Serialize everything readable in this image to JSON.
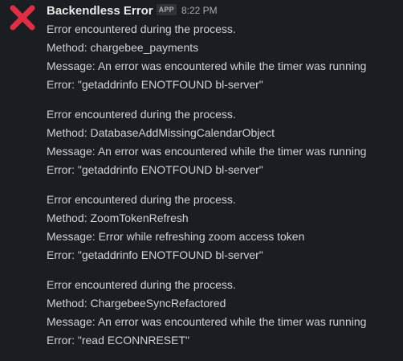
{
  "message": {
    "sender": "Backendless Error",
    "badge": "APP",
    "time": "8:22 PM",
    "avatar_icon": "red-x-icon",
    "avatar_color": "#dd2e44",
    "blocks": [
      {
        "line1": "Error encountered during the process.",
        "line2": "Method: chargebee_payments",
        "line3": "Message: An error was encountered while the timer was running",
        "line4": "Error: \"getaddrinfo ENOTFOUND bl-server\""
      },
      {
        "line1": "Error encountered during the process.",
        "line2": "Method: DatabaseAddMissingCalendarObject",
        "line3": "Message: An error was encountered while the timer was running",
        "line4": "Error: \"getaddrinfo ENOTFOUND bl-server\""
      },
      {
        "line1": "Error encountered during the process.",
        "line2": "Method: ZoomTokenRefresh",
        "line3": "Message: Error while refreshing zoom access token",
        "line4": "Error: \"getaddrinfo ENOTFOUND bl-server\""
      },
      {
        "line1": "Error encountered during the process.",
        "line2": "Method: ChargebeeSyncRefactored",
        "line3": "Message: An error was encountered while the timer was running",
        "line4": "Error: \"read ECONNRESET\""
      }
    ]
  }
}
